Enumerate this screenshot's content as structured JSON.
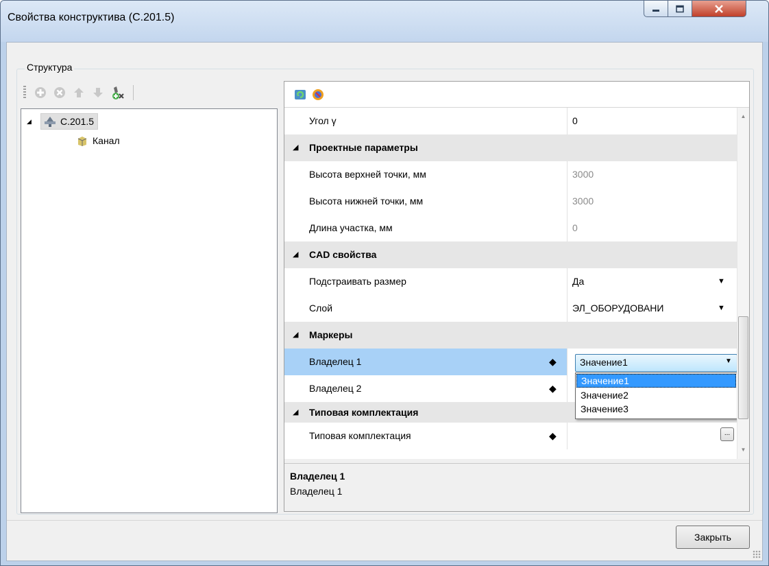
{
  "window": {
    "title": "Свойства конструктива (С.201.5)",
    "controls": {
      "minimize": "minimize",
      "maximize": "maximize",
      "close": "close"
    }
  },
  "structure": {
    "group_title": "Структура",
    "toolbar": [
      "add-icon",
      "delete-icon",
      "move-up-icon",
      "move-down-icon",
      "remove-element-icon"
    ],
    "tree": [
      {
        "label": "С.201.5",
        "expanded": true,
        "selected": true,
        "icon": "construction-icon"
      },
      {
        "label": "Канал",
        "icon": "channel-icon"
      }
    ]
  },
  "properties": {
    "toolbar": [
      "refresh-icon",
      "sort-icon"
    ],
    "rows": [
      {
        "type": "prop",
        "name": "Угол γ",
        "value": "0"
      },
      {
        "type": "category",
        "name": "Проектные параметры"
      },
      {
        "type": "prop",
        "name": "Высота верхней точки, мм",
        "value": "3000",
        "readonly": true
      },
      {
        "type": "prop",
        "name": "Высота нижней точки, мм",
        "value": "3000",
        "readonly": true
      },
      {
        "type": "prop",
        "name": "Длина участка, мм",
        "value": "0",
        "readonly": true
      },
      {
        "type": "category",
        "name": "CAD свойства"
      },
      {
        "type": "prop",
        "name": "Подстраивать размер",
        "value": "Да",
        "dropdown": true
      },
      {
        "type": "prop",
        "name": "Слой",
        "value": "ЭЛ_ОБОРУДОВАНИ",
        "dropdown": true
      },
      {
        "type": "category",
        "name": "Маркеры"
      },
      {
        "type": "prop",
        "name": "Владелец 1",
        "value": "Значение1",
        "marker": true,
        "selected": true
      },
      {
        "type": "prop",
        "name": "Владелец 2",
        "value": "",
        "marker": true
      },
      {
        "type": "category",
        "name": "Типовая комплектация"
      },
      {
        "type": "prop",
        "name": "Типовая комплектация",
        "value": "",
        "marker": true,
        "ellipsis": "..."
      }
    ],
    "dropdown_options": [
      "Значение1",
      "Значение2",
      "Значение3"
    ],
    "description": {
      "title": "Владелец 1",
      "text": "Владелец 1"
    }
  },
  "footer": {
    "close_label": "Закрыть"
  }
}
